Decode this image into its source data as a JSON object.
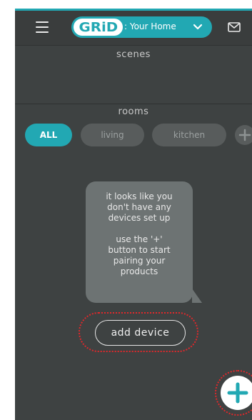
{
  "header": {
    "logo_text": "GRiD",
    "home_label": ": Your Home",
    "menu_icon": "hamburger-menu-icon",
    "dropdown_icon": "chevron-down-icon",
    "mail_icon": "envelope-icon"
  },
  "scenes": {
    "label": "scenes"
  },
  "rooms": {
    "label": "rooms",
    "items": [
      {
        "label": "ALL",
        "active": true
      },
      {
        "label": "living",
        "active": false
      },
      {
        "label": "kitchen",
        "active": false
      }
    ],
    "add_icon": "plus-icon"
  },
  "empty_state": {
    "line1": "it looks like you",
    "line2": "don't have any",
    "line3": "devices set up",
    "line4": "use the '+'",
    "line5": "button to start",
    "line6": "pairing your",
    "line7": "products"
  },
  "add_device": {
    "label": "add device"
  },
  "fab": {
    "icon": "plus-icon"
  },
  "colors": {
    "accent": "#22a8b3",
    "background": "#3e4242",
    "pill_inactive": "#585c5c",
    "bubble": "#6d7373",
    "highlight": "#e0282b"
  }
}
